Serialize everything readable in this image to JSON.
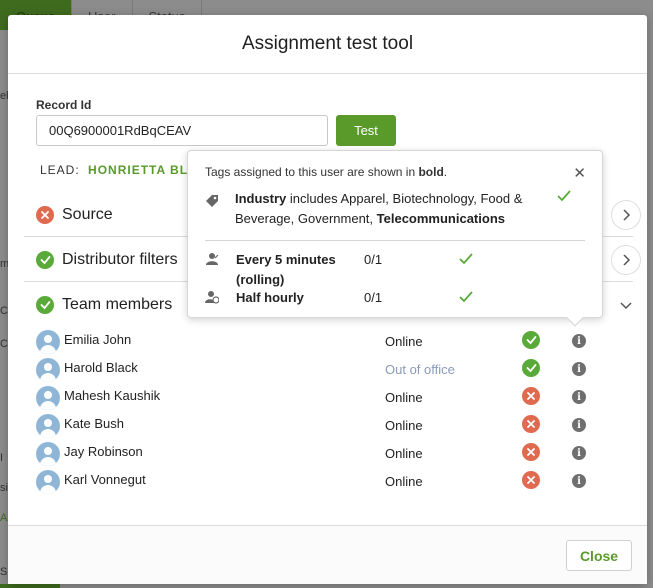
{
  "background": {
    "tabs": [
      "Queue",
      "User",
      "Status"
    ],
    "fragments": [
      "ele",
      "m",
      "C",
      "C",
      "I",
      "si",
      "A",
      "S"
    ]
  },
  "modal": {
    "title": "Assignment test tool",
    "record_label": "Record Id",
    "record_value": "00Q6900001RdBqCEAV",
    "test_label": "Test",
    "lead_prefix": "LEAD:",
    "lead_name": "HONRIETTA BLA",
    "close_label": "Close"
  },
  "sections": [
    {
      "label": "Source",
      "status": "fail"
    },
    {
      "label": "Distributor filters",
      "status": "pass"
    },
    {
      "label": "Team members",
      "status": "pass"
    }
  ],
  "members": [
    {
      "name": "Emilia John",
      "status": "Online",
      "match": "pass"
    },
    {
      "name": "Harold Black",
      "status": "Out of office",
      "match": "pass"
    },
    {
      "name": "Mahesh Kaushik",
      "status": "Online",
      "match": "fail"
    },
    {
      "name": "Kate Bush",
      "status": "Online",
      "match": "fail"
    },
    {
      "name": "Jay Robinson",
      "status": "Online",
      "match": "fail"
    },
    {
      "name": "Karl Vonnegut",
      "status": "Online",
      "match": "fail"
    }
  ],
  "popover": {
    "note_prefix": "Tags assigned to this user are shown in ",
    "note_bold": "bold",
    "note_suffix": ".",
    "industry_label": "Industry",
    "industry_mid": " includes Apparel, Biotechnology, Food & Beverage, Government, ",
    "industry_bold_tag": "Telecommunications",
    "rules": [
      {
        "name": "Every 5 minutes (rolling)",
        "count": "0/1"
      },
      {
        "name": "Half hourly",
        "count": "0/1"
      }
    ]
  },
  "colors": {
    "accent_green": "#5a9a2a",
    "pass_green": "#5aaa3a",
    "fail_red": "#e06a4f",
    "out_of_office": "#8a9bb8"
  }
}
